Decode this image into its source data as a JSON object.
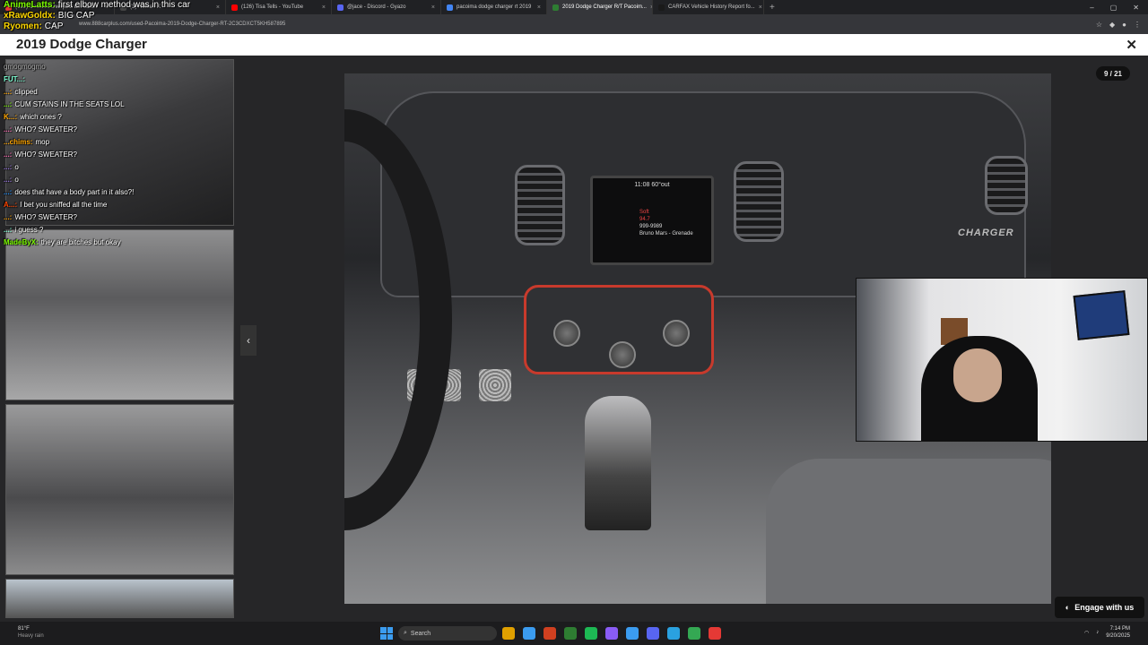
{
  "browser": {
    "tabs": [
      {
        "label": "(128) Deluded Liverpool fan calls...",
        "color": "#e53935",
        "active": false
      },
      {
        "label": "(3) Home / X",
        "color": "#444",
        "active": false
      },
      {
        "label": "(126) Tisa Tells - YouTube",
        "color": "#ff0000",
        "active": false
      },
      {
        "label": "@jace - Discord - Gyazo",
        "color": "#5865f2",
        "active": false
      },
      {
        "label": "pacoima dodge charger rt 2019",
        "color": "#4285f4",
        "active": false
      },
      {
        "label": "2019 Dodge Charger R/T Pacoim...",
        "color": "#2e7d32",
        "active": true
      },
      {
        "label": "CARFAX Vehicle History Report fo...",
        "color": "#1a1a1a",
        "active": false
      }
    ],
    "new_tab": "+",
    "url": "www.888carplus.com/used-Pacoima-2019-Dodge-Charger-RT-2C3CDXCT5KH587895"
  },
  "page": {
    "title": "2019 Dodge Charger",
    "close": "✕",
    "counter": "9 / 21",
    "prev": "‹",
    "screen_time": "11:08",
    "screen_temp": "60°out",
    "screen_station_label": "Soft",
    "screen_freq": "94.7",
    "screen_phone": "999-9989",
    "screen_song": "Bruno Mars - Grenade",
    "badge": "CHARGER",
    "engage": "Engage with us"
  },
  "chat": {
    "top": [
      {
        "user": "AnimeLatts:",
        "text": "first elbow method was in this car",
        "color": "#7cfc00"
      },
      {
        "user": "xRawGoldx:",
        "text": "BIG CAP",
        "color": "#ffd700"
      },
      {
        "user": "Ryomen:",
        "text": "CAP",
        "color": "#ffd700"
      }
    ],
    "badge_line": "gmogmogmo",
    "lines": [
      {
        "user": "FUT...:",
        "text": "",
        "color": "#7fffd4"
      },
      {
        "user": "...:",
        "text": "clipped",
        "color": "#ffa500"
      },
      {
        "user": "...:",
        "text": "CUM STAINS IN THE SEATS LOL",
        "color": "#7cfc00"
      },
      {
        "user": "K...:",
        "text": "which ones ?",
        "color": "#ffa500"
      },
      {
        "user": "...:",
        "text": "WHO? SWEATER?",
        "color": "#ff69b4"
      },
      {
        "user": "...chims:",
        "text": "mop",
        "color": "#ffa500"
      },
      {
        "user": "...:",
        "text": "WHO? SWEATER?",
        "color": "#ff69b4"
      },
      {
        "user": "...:",
        "text": "o",
        "color": "#9370db"
      },
      {
        "user": "...:",
        "text": "o",
        "color": "#9370db"
      },
      {
        "user": "...:",
        "text": "does that have a body part in it also?!",
        "color": "#1e90ff"
      },
      {
        "user": "A...:",
        "text": "I bet you sniffed all the time",
        "color": "#ff4500"
      },
      {
        "user": "...:",
        "text": "WHO? SWEATER?",
        "color": "#ffa500"
      },
      {
        "user": "...:",
        "text": "i guess ?",
        "color": "#7fffd4"
      },
      {
        "user": "MadeByX:",
        "text": "they are bitches but okay",
        "color": "#7cfc00"
      }
    ]
  },
  "taskbar": {
    "weather_temp": "81°F",
    "weather_desc": "Heavy rain",
    "search_label": "Search",
    "time": "7:14 PM",
    "date": "9/20/2025",
    "apps": [
      "#e0a000",
      "#3b9cf0",
      "#d04020",
      "#2e7d32",
      "#1db954",
      "#8a5cf5",
      "#3b9cf0",
      "#5865f2",
      "#2aa1e0",
      "#34a853",
      "#e53935"
    ]
  }
}
